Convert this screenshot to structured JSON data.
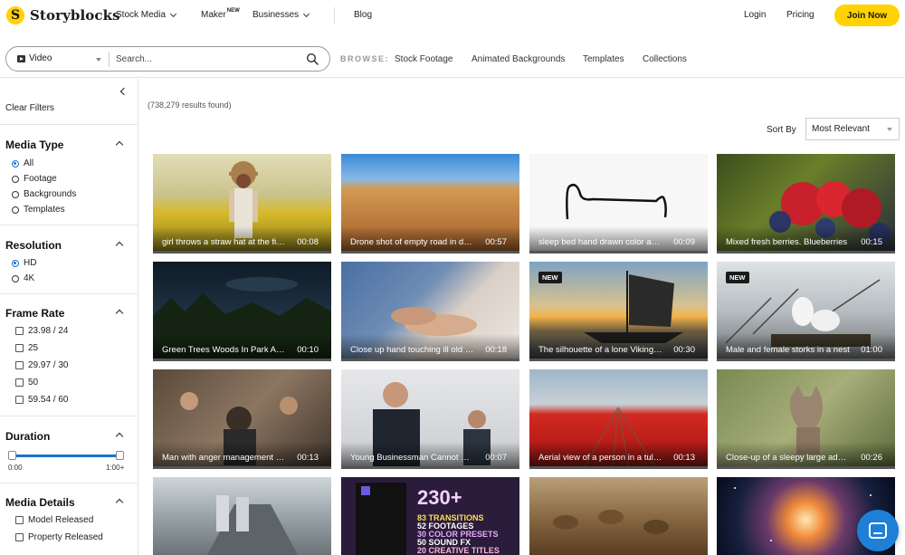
{
  "topnav": {
    "logo_mark": "S",
    "logo_text": "Storyblocks",
    "stock_media": "Stock Media",
    "maker": "Maker",
    "maker_badge": "NEW",
    "businesses": "Businesses",
    "blog": "Blog",
    "login": "Login",
    "pricing": "Pricing",
    "join": "Join Now"
  },
  "search": {
    "type_label": "Video",
    "placeholder": "Search...",
    "browse_label": "BROWSE:",
    "browse_links": [
      "Stock Footage",
      "Animated Backgrounds",
      "Templates",
      "Collections"
    ]
  },
  "sidebar": {
    "clear_filters": "Clear Filters",
    "media_type": {
      "title": "Media Type",
      "options": [
        "All",
        "Footage",
        "Backgrounds",
        "Templates"
      ],
      "selected": "All"
    },
    "resolution": {
      "title": "Resolution",
      "options": [
        "HD",
        "4K"
      ],
      "selected": "HD"
    },
    "frame_rate": {
      "title": "Frame Rate",
      "options": [
        "23.98 / 24",
        "25",
        "29.97 / 30",
        "50",
        "59.54 / 60"
      ]
    },
    "duration": {
      "title": "Duration",
      "min_label": "0:00",
      "max_label": "1:00+"
    },
    "media_details": {
      "title": "Media Details",
      "options": [
        "Model Released",
        "Property Released"
      ]
    }
  },
  "main": {
    "results": "(738,279 results found)",
    "sort_by_label": "Sort By",
    "sort_value": "Most Relevant",
    "items": [
      {
        "title": "girl throws a straw hat at the field",
        "duration": "00:08"
      },
      {
        "title": "Drone shot of empty road in desert",
        "duration": "00:57"
      },
      {
        "title": "sleep bed hand drawn color animation",
        "duration": "00:09"
      },
      {
        "title": "Mixed fresh berries. Blueberries",
        "duration": "00:15"
      },
      {
        "title": "Green Trees Woods In Park At Night",
        "duration": "00:10"
      },
      {
        "title": "Close up hand touching ill old man",
        "duration": "00:18"
      },
      {
        "title": "The silhouette of a lone Viking ship",
        "duration": "00:30",
        "badge": "NEW"
      },
      {
        "title": "Male and female storks in a nest",
        "duration": "01:00",
        "badge": "NEW"
      },
      {
        "title": "Man with anger management issues",
        "duration": "00:13"
      },
      {
        "title": "Young Businessman Cannot Stand",
        "duration": "00:07"
      },
      {
        "title": "Aerial view of a person in a tulip field",
        "duration": "00:13"
      },
      {
        "title": "Close-up of a sleepy large adult wolf",
        "duration": "00:26"
      }
    ],
    "promo": {
      "n": "230+",
      "lines": [
        "83 TRANSITIONS",
        "52 FOOTAGES",
        "30 COLOR PRESETS",
        "50 SOUND FX",
        "20 CREATIVE TITLES"
      ]
    }
  },
  "colors": {
    "brand_yellow": "#FFD200",
    "accent_blue": "#1a73c8",
    "chat_blue": "#1e7fd8"
  }
}
